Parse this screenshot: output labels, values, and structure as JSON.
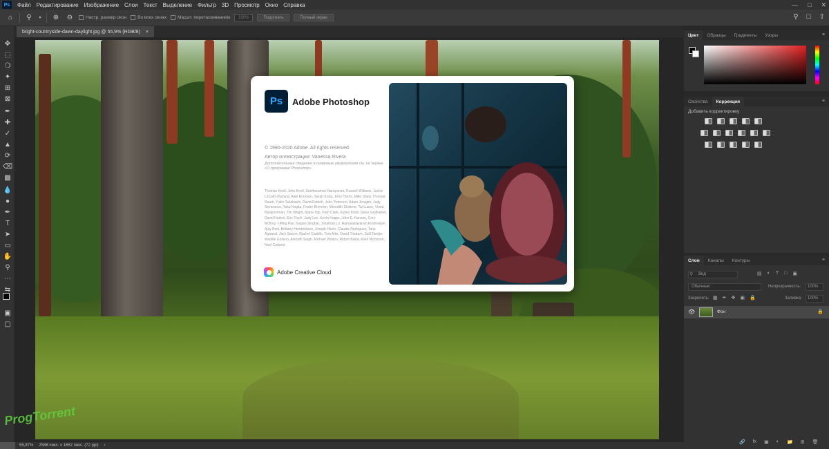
{
  "menu": {
    "logo": "Ps",
    "items": [
      "Файл",
      "Редактирование",
      "Изображение",
      "Слои",
      "Текст",
      "Выделение",
      "Фильтр",
      "3D",
      "Просмотр",
      "Окно",
      "Справка"
    ]
  },
  "options_bar": {
    "resize_windows": "Настр. размер окон",
    "all_windows": "Во всех окнах",
    "scrubby_zoom": "Масшт. перетаскиванием",
    "zoom_value": "100%",
    "fit_screen": "Подогнать",
    "fill_screen": "Полный экран"
  },
  "document": {
    "tab_title": "bright-countryside-dawn-daylight.jpg @ 55,9% (RGB/8)",
    "tab_close": "×"
  },
  "status_bar": {
    "zoom": "55,87%",
    "doc_info": "2588 пикс. x 1652 пикс. (72 ppi)",
    "arrow": "›"
  },
  "watermark": "ProgTorrent",
  "splash": {
    "logo": "Ps",
    "title": "Adobe Photoshop",
    "copyright": "© 1990-2020 Adobe. All rights reserved.",
    "artist": "Автор иллюстрации: Vanessa Rivera",
    "legal": "Дополнительные сведения и правовые уведомления см. на экране «О программе Photoshop».",
    "credits": "Thomas Knoll, John Knoll, Seetharaman Narayanan, Russell Williams, Jackie Lincoln-Owyang, Alan Erickson, Sarah Kong, Jerry Harris, Mike Shaw, Thomas Ruark, Yukie Takahashi, David Dobish, John Peterson, Adam Jerugim, Judy Severance, Yuko Kagita, Foster Brereton, Meredith Stotzner, Tai Luxon, Vinod Balakrishnan, Tim Wright, Maria Yap, Pam Clark, Kyoko Itoda, Steve Guilhamet, David Hackel, Eric Floch, Judy Lee, Kevin Hopps, John E. Hanson, Cory McIlroy, I-Ming Pao, Gagan Singhal, Jonathan Lo, Ramanarayanan Krishnaiyer, Ajay Bedi, Brittany Hendrickson, Joseph Hsieh, Claudia Rodriguez, Tanu Agarwal, Jack Sisson, Rachel Castillo, Tom Attix, David Tristram, Salil Tambe, Maddie Golison, Anirudh Singh, Michael Vitrano, Ridam Batra, Mark Nichoson, Noel Carboni",
    "cc_label": "Adobe Creative Cloud"
  },
  "panels": {
    "color_tabs": [
      "Цвет",
      "Образцы",
      "Градиенты",
      "Узоры"
    ],
    "adjust_tabs": [
      "Свойства",
      "Коррекция"
    ],
    "adjust_hint": "Добавить корректировку",
    "layers_tabs": [
      "Слои",
      "Каналы",
      "Контуры"
    ],
    "layer_kind": "Вид",
    "blend_mode": "Обычные",
    "opacity_label": "Непрозрачность:",
    "opacity_value": "100%",
    "lock_label": "Закрепить:",
    "fill_label": "Заливка:",
    "fill_value": "100%",
    "layer_name": "Фон",
    "menu_icon": "≡"
  },
  "colors": {
    "accent": "#31a8ff",
    "ps_bg": "#001e36",
    "panel_bg": "#323232",
    "canvas_bg": "#262626"
  }
}
